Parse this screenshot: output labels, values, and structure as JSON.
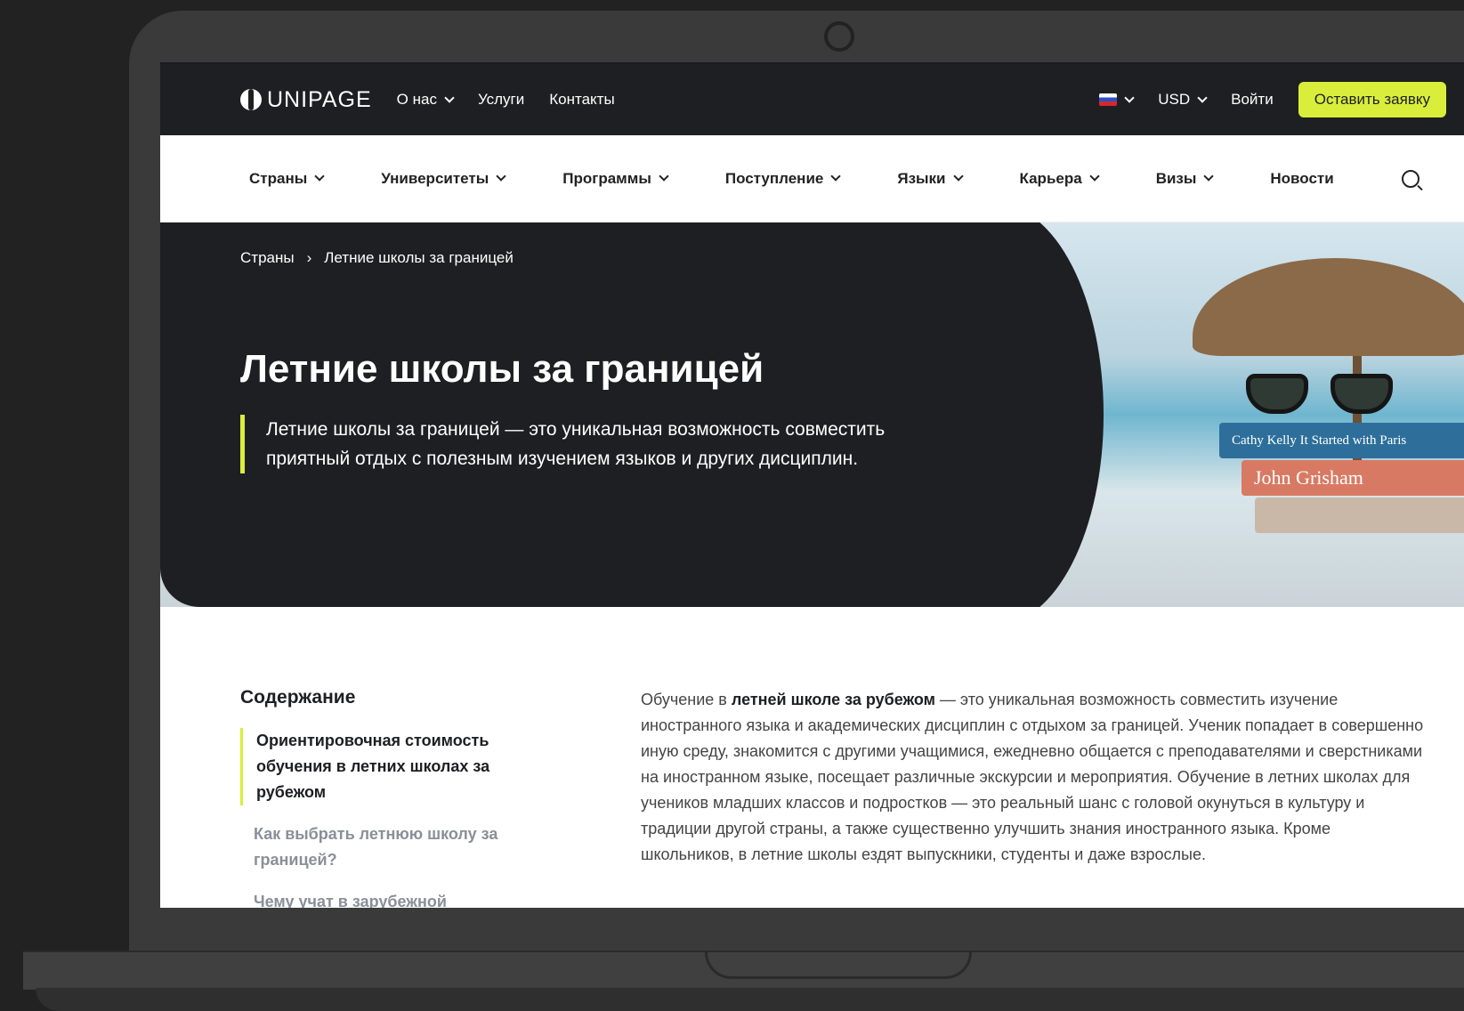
{
  "brand": {
    "logo_text": "UNIPAGE"
  },
  "topbar": {
    "nav": [
      {
        "label": "О нас",
        "has_dropdown": true
      },
      {
        "label": "Услуги",
        "has_dropdown": false
      },
      {
        "label": "Контакты",
        "has_dropdown": false
      }
    ],
    "currency": "USD",
    "login": "Войти",
    "cta": "Оставить заявку",
    "accent_color": "#d9ee3a"
  },
  "mainnav": [
    {
      "label": "Страны"
    },
    {
      "label": "Университеты"
    },
    {
      "label": "Программы"
    },
    {
      "label": "Поступление"
    },
    {
      "label": "Языки"
    },
    {
      "label": "Карьера"
    },
    {
      "label": "Визы"
    },
    {
      "label": "Новости"
    }
  ],
  "hero": {
    "breadcrumb": [
      "Страны",
      "Летние школы за границей"
    ],
    "title": "Летние школы за границей",
    "lead": "Летние школы за границей — это уникальная возможность совместить приятный отдых с полезным изучением языков и других дисциплин.",
    "book_titles": [
      "Cathy Kelly  It Started with Paris",
      "John Grisham"
    ]
  },
  "toc": {
    "title": "Содержание",
    "items": [
      "Ориентировочная стоимость обучения в летних школах за рубежом",
      "Как выбрать летнюю школу за границей?",
      "Чему учат в зарубежной"
    ]
  },
  "article": {
    "intro_pre": "Обучение в ",
    "intro_bold": "летней школе за рубежом",
    "intro_post": " — это уникальная возможность совместить изучение иностранного языка и академических дисциплин с отдыхом за границей. Ученик попадает в совершенно иную среду, знакомится с другими учащимися, ежедневно общается с преподавателями и сверстниками на иностранном языке, посещает различные экскурсии и мероприятия. Обучение в летних школах для учеников младших классов и подростков — это реальный шанс с головой окунуться в культуру и традиции другой страны, а также существенно улучшить знания иностранного языка. Кроме школьников, в летние школы ездят выпускники, студенты и даже взрослые."
  }
}
